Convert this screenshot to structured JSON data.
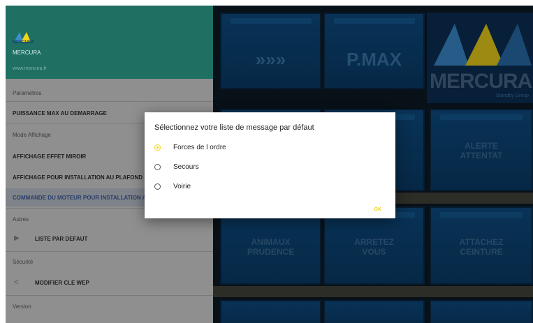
{
  "app": {
    "name": "MERCURA",
    "url": "www.mercura.fr",
    "logo_text": "MERCURA"
  },
  "tiles": {
    "arrows": "»»»",
    "pmax": "P.MAX",
    "logo_big": "MERCURA",
    "logo_sub": "Standby Group",
    "alerte": "ALERTE\nATTENTAT",
    "animaux": "ANIMAUX\nPRUDENCE",
    "arretez": "ARRETEZ\nVOUS",
    "attachez": "ATTACHEZ\nCEINTURE"
  },
  "settings": {
    "parametres": "Paramètres",
    "puissance": "PUISSANCE MAX AU DEMARRAGE",
    "mode_affichage": "Mode Affichage",
    "miroir": "AFFICHAGE EFFET MIROIR",
    "plafond": "AFFICHAGE POUR INSTALLATION AU PLAFOND",
    "commande": "COMMANDE DU MOTEUR POUR INSTALLATION AU",
    "autres": "Autres",
    "liste": "LISTE PAR DEFAUT",
    "securite": "Sécurité",
    "wep": "MODIFIER CLE WEP",
    "version": "Version"
  },
  "dialog": {
    "title": "Sélectionnez votre liste de message par défaut",
    "options": [
      "Forces de l ordre",
      "Secours",
      "Voirie"
    ],
    "selected": "Forces de l ordre",
    "ok": "OK"
  },
  "colors": {
    "accent": "#f2d51c",
    "header": "#1f6f63",
    "tile": "#0e4f86"
  }
}
